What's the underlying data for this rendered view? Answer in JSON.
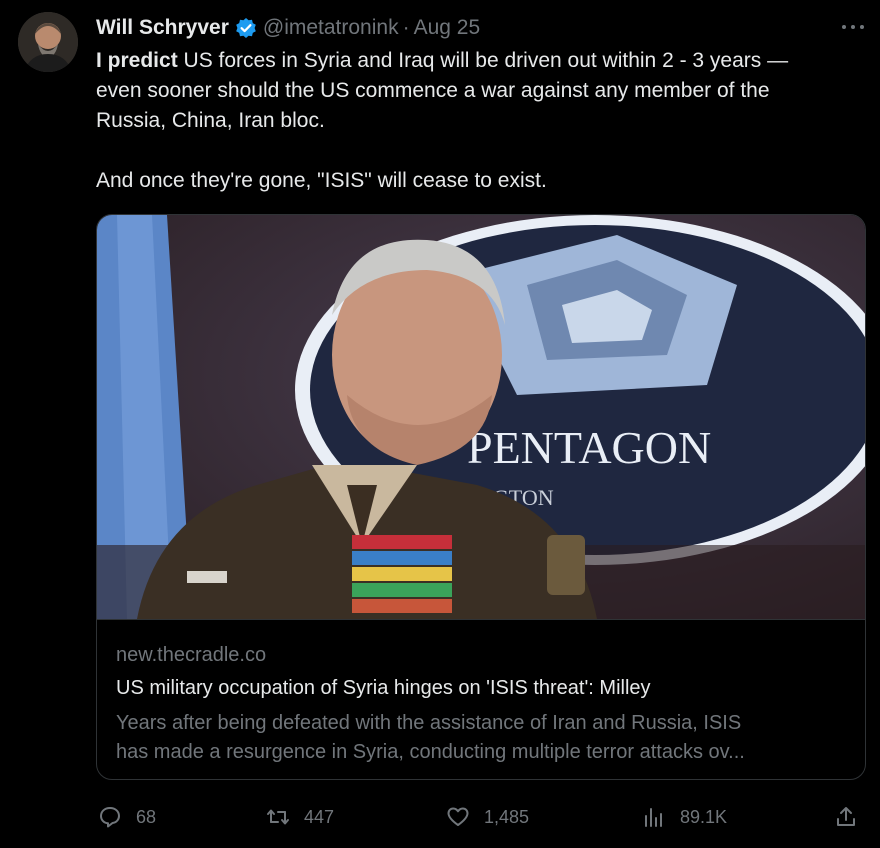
{
  "author": {
    "name": "Will Schryver",
    "handle": "@imetatronink",
    "separator": "·",
    "date": "Aug 25"
  },
  "tweet": {
    "lead_bold": "I predict",
    "line1": " US forces in Syria and Iraq will be driven out within 2 - 3 years —",
    "line2": "even sooner should the US commence a war against any member of the",
    "line3": "Russia, China, Iran bloc.",
    "line4": "And once they're gone, \"ISIS\" will cease to exist."
  },
  "card": {
    "image_text_main": "PENTAGON",
    "image_text_sub": "NGTON",
    "domain": "new.thecradle.co",
    "title": "US military occupation of Syria hinges on 'ISIS threat': Milley",
    "desc_line1": "Years after being defeated with the assistance of Iran and Russia, ISIS",
    "desc_line2": "has made a resurgence in Syria, conducting multiple terror attacks ov..."
  },
  "actions": {
    "replies": "68",
    "reposts": "447",
    "likes": "1,485",
    "views": "89.1K"
  },
  "colors": {
    "background": "#000000",
    "text": "#e7e9ea",
    "muted": "#71767b",
    "verified": "#1d9bf0",
    "border": "#2f3336"
  },
  "icons": [
    "verified-badge-icon",
    "more-icon",
    "reply-icon",
    "repost-icon",
    "like-icon",
    "views-icon",
    "share-icon"
  ]
}
